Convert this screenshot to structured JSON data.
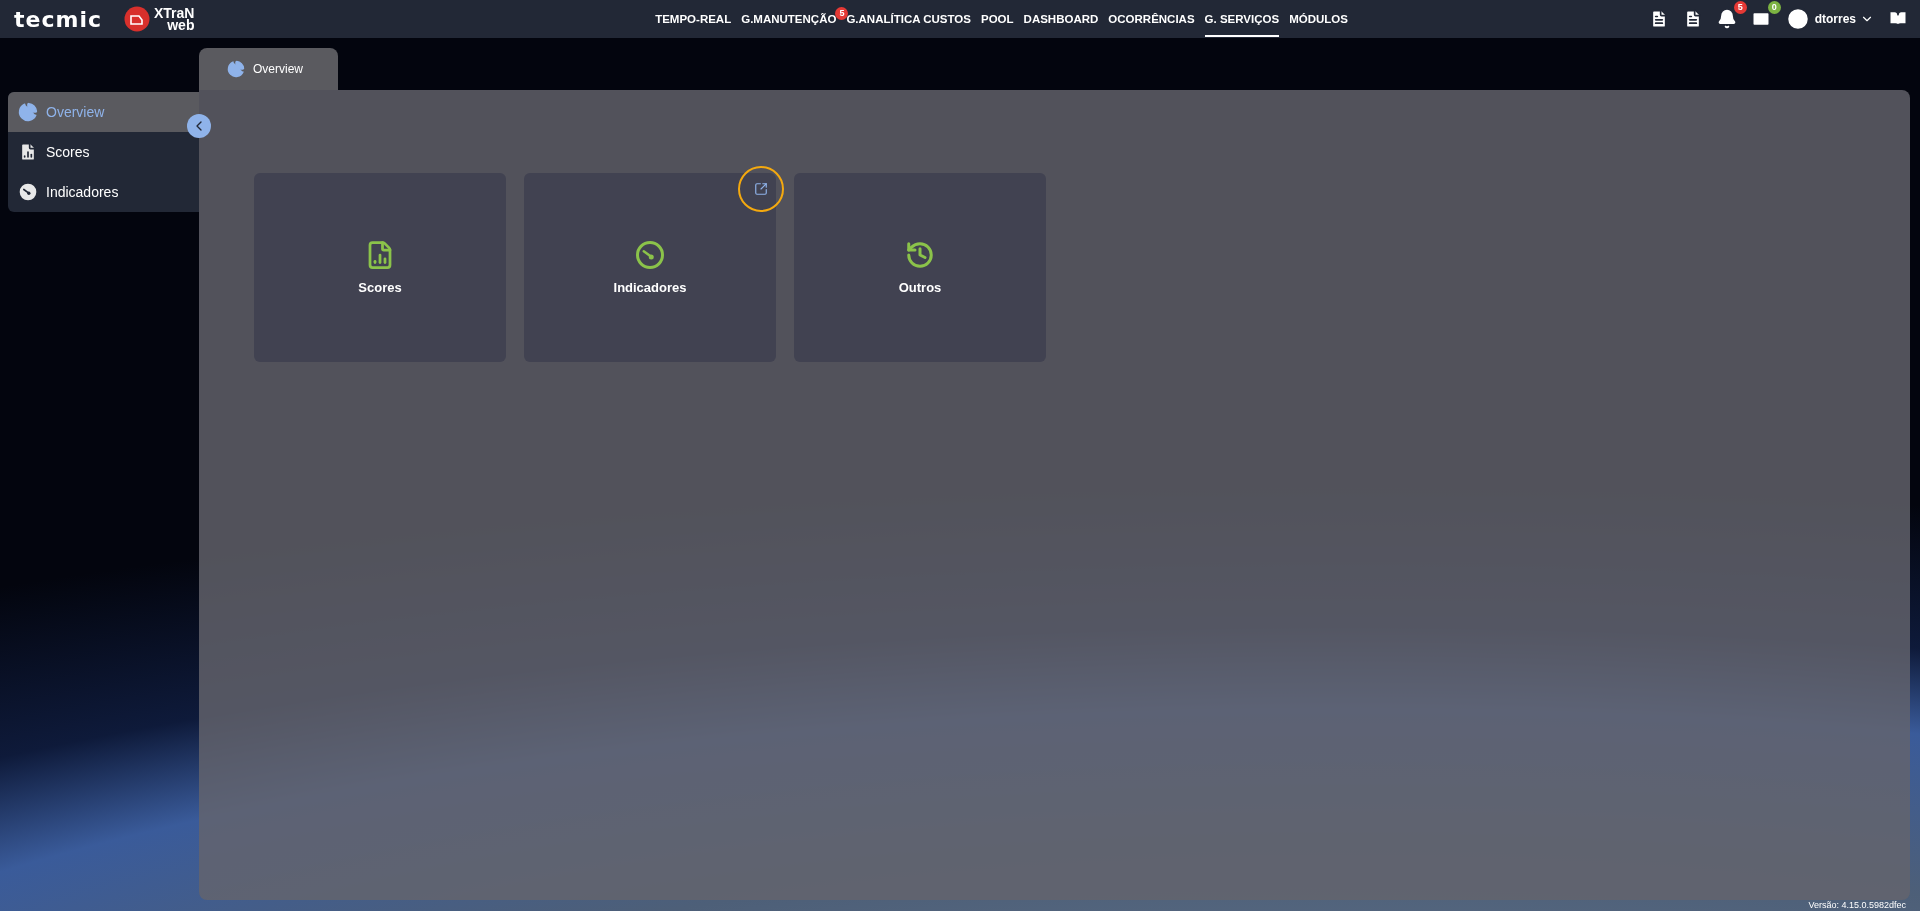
{
  "header": {
    "brand": "tecmic",
    "product": {
      "line_1": "XTraN",
      "line_2": "web"
    },
    "nav": [
      {
        "label": "TEMPO-REAL",
        "selected": false
      },
      {
        "label": "G.MANUTENÇÃO",
        "selected": false,
        "badge": "5"
      },
      {
        "label": "G.ANALÍTICA CUSTOS",
        "selected": false
      },
      {
        "label": "POOL",
        "selected": false
      },
      {
        "label": "DASHBOARD",
        "selected": false
      },
      {
        "label": "OCORRÊNCIAS",
        "selected": false
      },
      {
        "label": "G. SERVIÇOS",
        "selected": true
      },
      {
        "label": "MÓDULOS",
        "selected": false
      }
    ],
    "notifications_badge": "5",
    "messages_badge": "0",
    "user": "dtorres"
  },
  "sidebar": {
    "items": [
      {
        "label": "Overview",
        "selected": true
      },
      {
        "label": "Scores",
        "selected": false
      },
      {
        "label": "Indicadores",
        "selected": false
      }
    ]
  },
  "tab": {
    "label": "Overview"
  },
  "cards": [
    {
      "label": "Scores",
      "external_link": false
    },
    {
      "label": "Indicadores",
      "external_link": true
    },
    {
      "label": "Outros",
      "external_link": false
    }
  ],
  "version": "Versão: 4.15.0.5982dfec"
}
